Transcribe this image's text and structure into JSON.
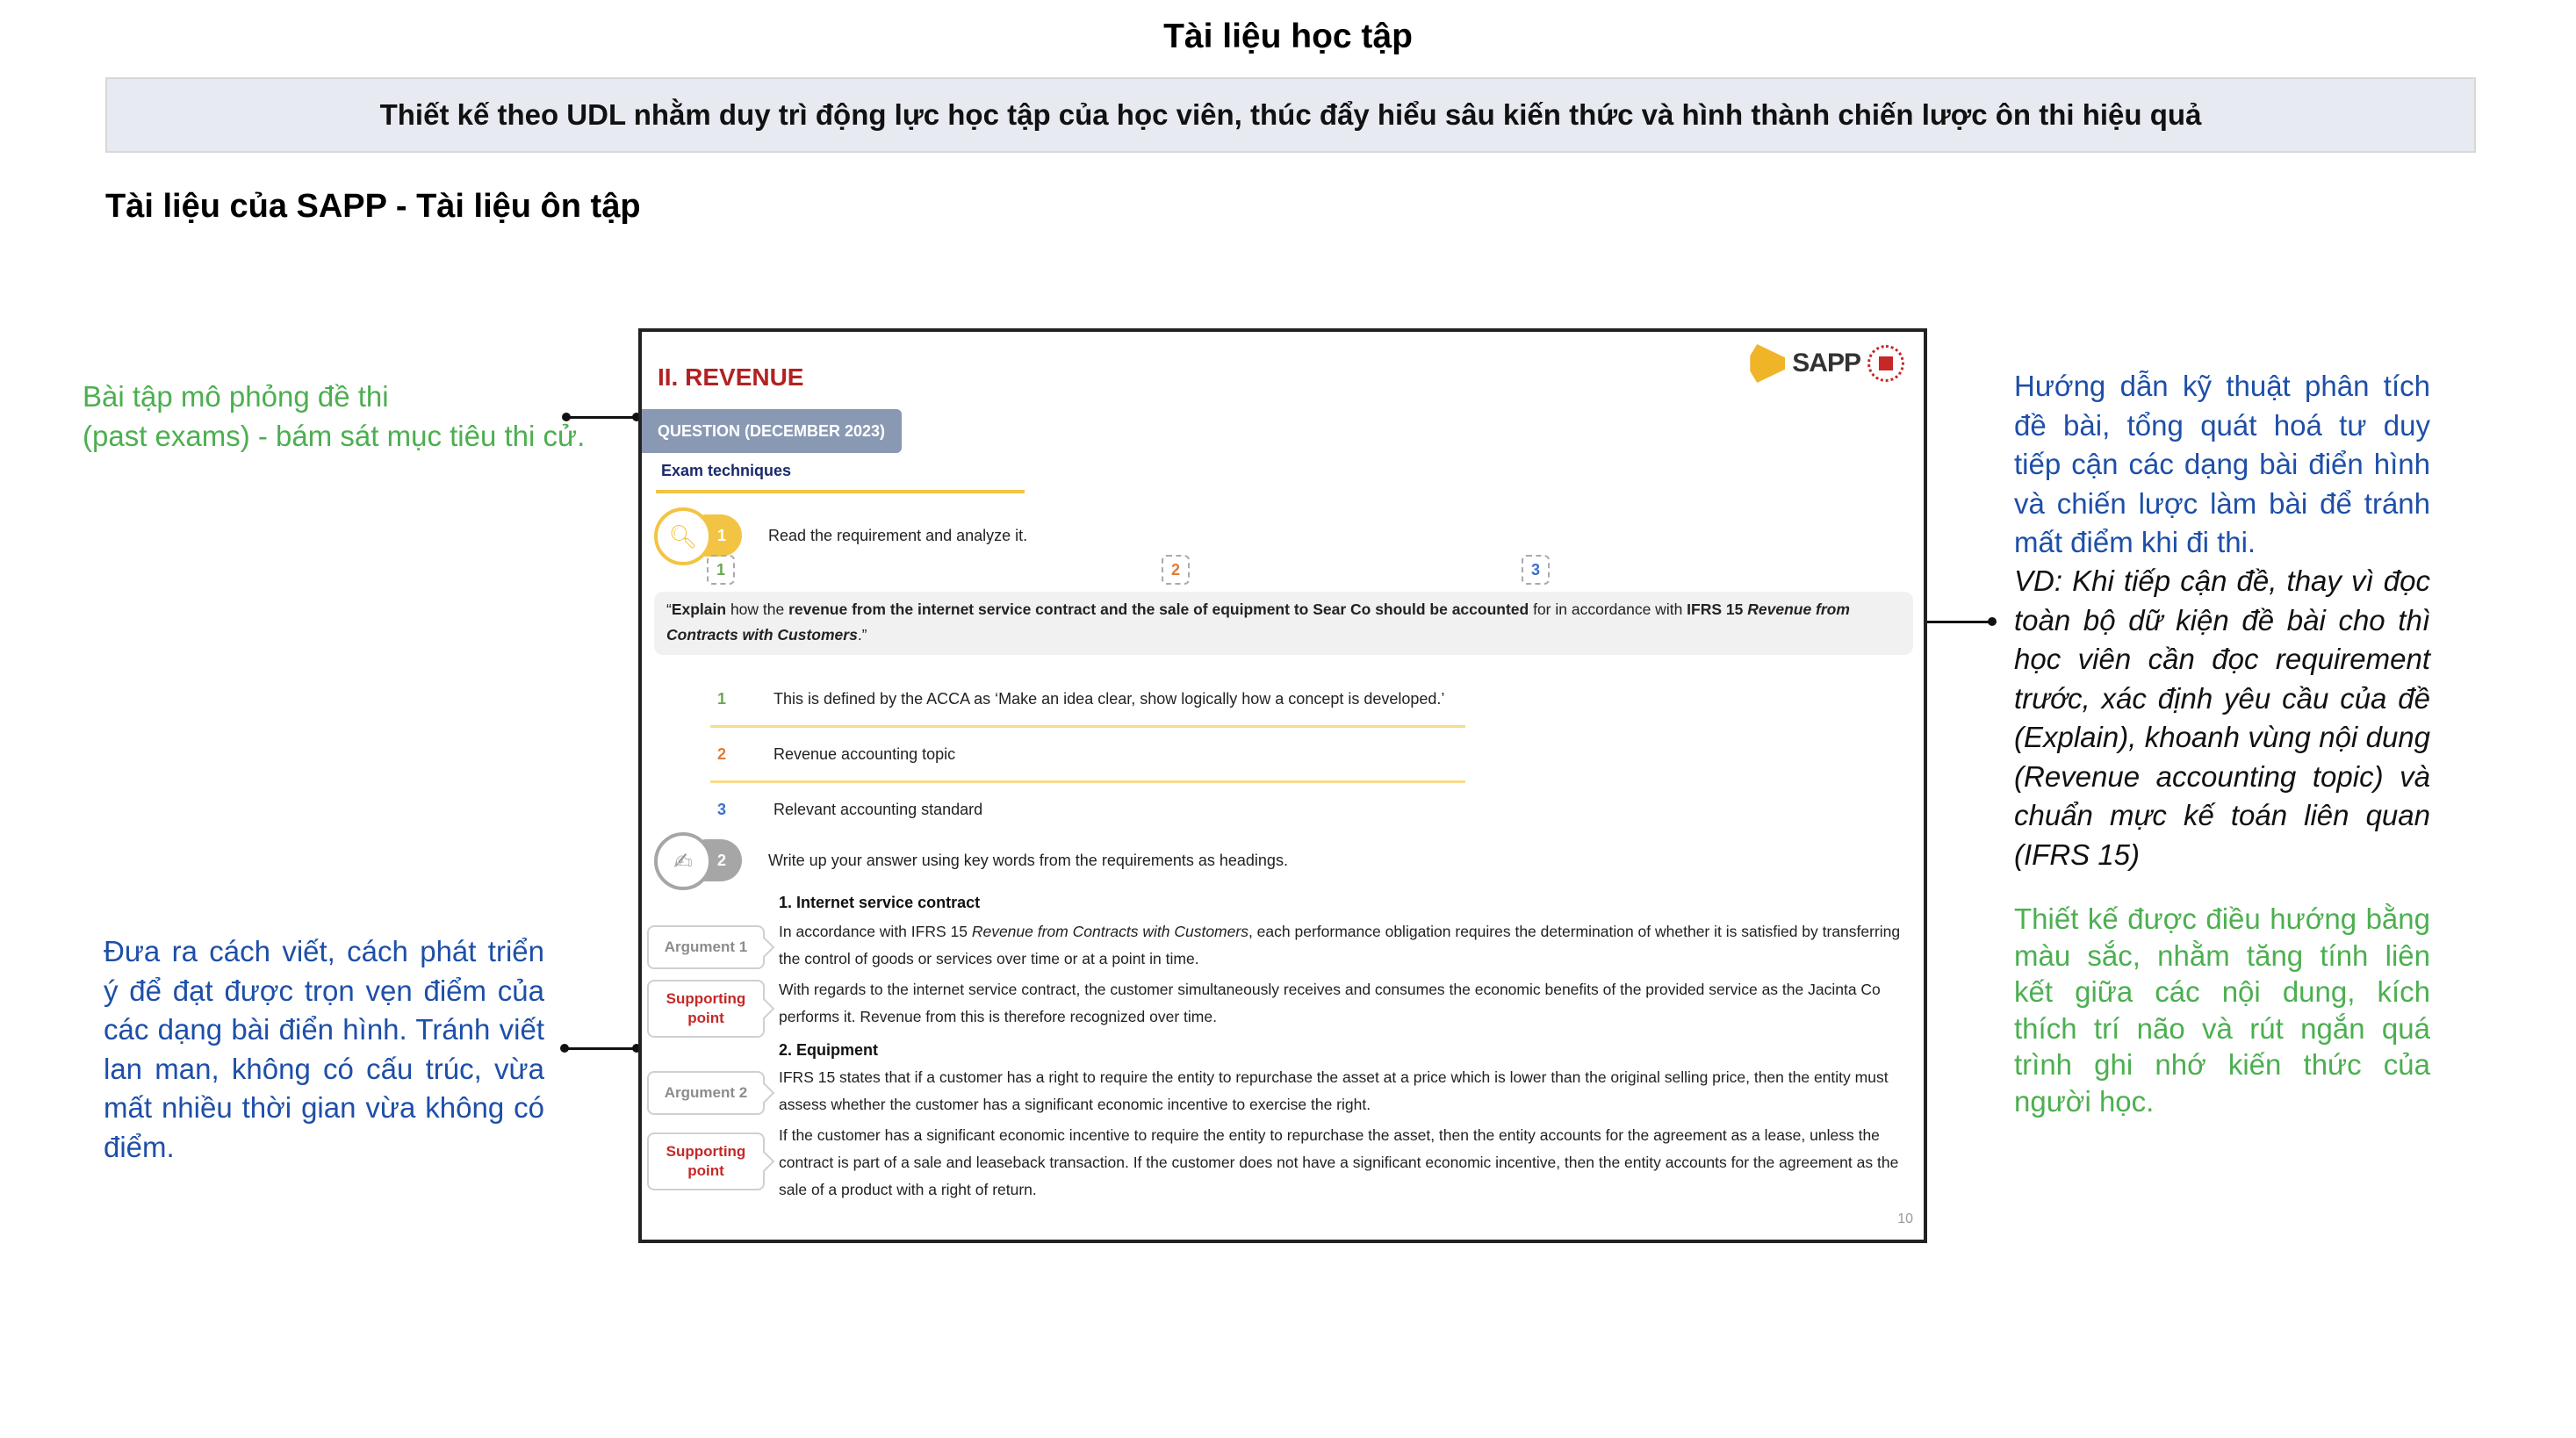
{
  "header": {
    "title": "Tài liệu học tập",
    "banner": "Thiết kế theo UDL nhằm duy trì động lực học tập của học viên, thúc đẩy hiểu sâu kiến thức và hình thành chiến lược ôn thi hiệu quả",
    "section_title": "Tài liệu của SAPP - Tài liệu ôn tập"
  },
  "colors": {
    "green": "#4caf50",
    "blue": "#1e4fa8",
    "slide_heading_red": "#b22222",
    "accent_yellow": "#f3c444",
    "question_tab": "#8a99b3",
    "banner_bg": "#e8eaf2"
  },
  "annotations": {
    "left_top_line1": "Bài tập mô phỏng đề thi",
    "left_top_line2": "(past exams) - bám sát mục tiêu thi cử.",
    "left_bottom": "Đưa ra cách viết, cách phát triển ý để đạt được trọn vẹn điểm của các dạng bài điển hình. Tránh viết lan man, không có cấu trúc, vừa mất nhiều thời gian vừa không có điểm.",
    "right_top": "Hướng dẫn kỹ thuật phân tích đề bài, tổng quát hoá tư duy tiếp cận các dạng bài điển hình và chiến lược làm bài để tránh mất điểm khi đi thi.",
    "right_example": "VD: Khi tiếp cận đề, thay vì đọc toàn bộ dữ kiện đề bài cho thì học viên cần đọc requirement trước, xác định yêu cầu của đề (Explain), khoanh vùng nội dung (Revenue accounting topic) và chuẩn mực kế toán liên quan (IFRS 15)",
    "right_bottom": "Thiết kế được điều hướng bằng màu sắc, nhằm tăng tính liên kết giữa các nội dung, kích thích trí não và rút ngắn quá trình ghi nhớ kiến thức của người học."
  },
  "slide": {
    "heading": "II. REVENUE",
    "logo_text": "SAPP",
    "question_tab": "QUESTION (DECEMBER 2023)",
    "exam_techniques": "Exam techniques",
    "step1": {
      "number": "1",
      "text": "Read the requirement and analyze it."
    },
    "tags": [
      {
        "number": "1",
        "color": "#6aa84f"
      },
      {
        "number": "2",
        "color": "#e07b39"
      },
      {
        "number": "3",
        "color": "#3c6fc8"
      }
    ],
    "requirement": {
      "open_quote": "“",
      "p1_bold": "Explain",
      "p2": " how the ",
      "p3_bold": "revenue from the internet service contract and the sale of equipment to Sear Co should be accounted",
      "p4": " for in accordance with ",
      "p5_bold": "IFRS 15 ",
      "p6_bold_italic": "Revenue from Contracts with Customers",
      "close_quote": ".”"
    },
    "definitions": [
      {
        "number": "1",
        "text": "This is defined by the ACCA as ‘Make an idea clear, show logically how a concept is developed.’",
        "color": "#6aa84f"
      },
      {
        "number": "2",
        "text": "Revenue accounting topic",
        "color": "#e07b39"
      },
      {
        "number": "3",
        "text": "Relevant accounting standard",
        "color": "#3c6fc8"
      }
    ],
    "step2": {
      "number": "2",
      "text": "Write up your answer using key words from the requirements as headings."
    },
    "answer": {
      "heading1": "1. Internet service contract",
      "argument1_label": "Argument 1",
      "argument1_pre": "In accordance with IFRS 15 ",
      "argument1_italic": "Revenue from Contracts with Customers",
      "argument1_post": ", each performance obligation requires the determination of whether it is satisfied by transferring the control of goods or services over time or at a point in time.",
      "support1_label_l1": "Supporting",
      "support1_label_l2": "point",
      "support1_text": "With regards to the internet service contract, the customer simultaneously receives and consumes the economic benefits of the provided service as the Jacinta Co performs it. Revenue from this is therefore recognized over time.",
      "heading2": "2. Equipment",
      "argument2_label": "Argument 2",
      "argument2_text": "IFRS 15 states that if a customer has a right to require the entity to repurchase the asset at a price which is lower than the original selling price, then the entity must assess whether the customer has a significant economic incentive to exercise the right.",
      "support2_label_l1": "Supporting",
      "support2_label_l2": "point",
      "support2_text": "If the customer has a significant economic incentive to require the entity to repurchase the asset, then the entity accounts for the agreement as a lease, unless the contract is part of a sale and leaseback transaction. If the customer does not have a significant economic incentive, then the entity accounts for the agreement as the sale of a product with a right of return."
    },
    "page_number": "10"
  }
}
